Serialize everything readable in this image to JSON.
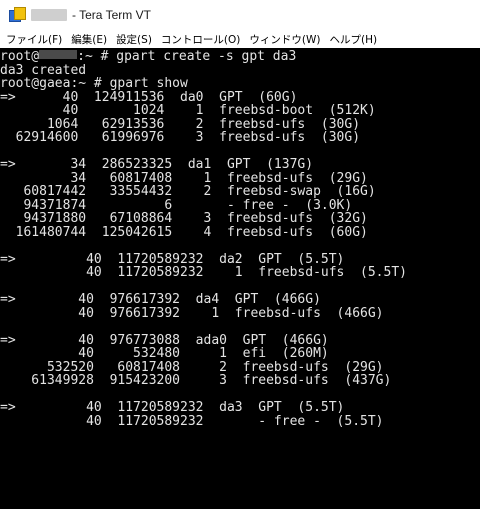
{
  "window": {
    "title": "- Tera Term VT"
  },
  "menu": [
    "ファイル(F)",
    "編集(E)",
    "設定(S)",
    "コントロール(O)",
    "ウィンドウ(W)",
    "ヘルプ(H)"
  ],
  "terminal": {
    "line_0_host": "root@",
    "line_0_rest": ":~ # gpart create -s gpt da3",
    "line_1": "da3 created",
    "line_2": "root@gaea:~ # gpart show",
    "line_3": "=>      40  124911536  da0  GPT  (60G)",
    "line_4": "        40       1024    1  freebsd-boot  (512K)",
    "line_5": "      1064   62913536    2  freebsd-ufs  (30G)",
    "line_6": "  62914600   61996976    3  freebsd-ufs  (30G)",
    "line_7": "",
    "line_8": "=>       34  286523325  da1  GPT  (137G)",
    "line_9": "         34   60817408    1  freebsd-ufs  (29G)",
    "line_10": "   60817442   33554432    2  freebsd-swap  (16G)",
    "line_11": "   94371874          6       - free -  (3.0K)",
    "line_12": "   94371880   67108864    3  freebsd-ufs  (32G)",
    "line_13": "  161480744  125042615    4  freebsd-ufs  (60G)",
    "line_14": "",
    "line_15": "=>         40  11720589232  da2  GPT  (5.5T)",
    "line_16": "           40  11720589232    1  freebsd-ufs  (5.5T)",
    "line_17": "",
    "line_18": "=>        40  976617392  da4  GPT  (466G)",
    "line_19": "          40  976617392    1  freebsd-ufs  (466G)",
    "line_20": "",
    "line_21": "=>        40  976773088  ada0  GPT  (466G)",
    "line_22": "          40     532480     1  efi  (260M)",
    "line_23": "      532520   60817408     2  freebsd-ufs  (29G)",
    "line_24": "    61349928  915423200     3  freebsd-ufs  (437G)",
    "line_25": "",
    "line_26": "=>         40  11720589232  da3  GPT  (5.5T)",
    "line_27": "           40  11720589232       - free -  (5.5T)"
  }
}
